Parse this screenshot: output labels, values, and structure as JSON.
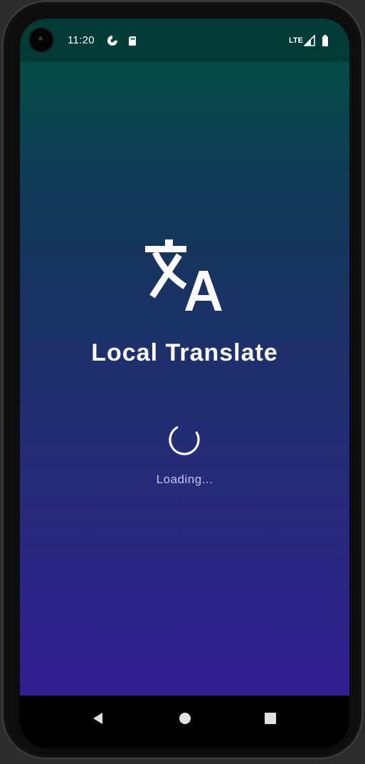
{
  "status_bar": {
    "time": "11:20",
    "network": "LTE",
    "icons": [
      "data-saver-icon",
      "sd-card-icon",
      "signal-icon",
      "battery-icon"
    ]
  },
  "app": {
    "logo_icon": "translate-icon",
    "title": "Local Translate",
    "loading_text": "Loading...",
    "colors": {
      "gradient_top": "#054b47",
      "gradient_bottom": "#321f8f",
      "status_bar": "#023b36"
    }
  },
  "navigation": {
    "buttons": [
      "back-icon",
      "home-icon",
      "recents-icon"
    ]
  }
}
